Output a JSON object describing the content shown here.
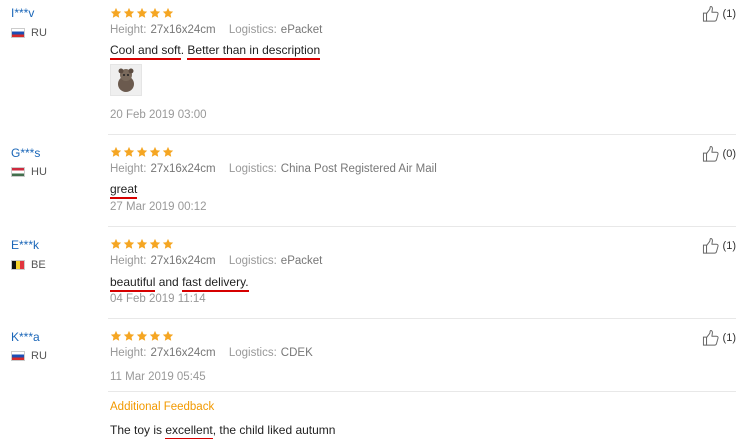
{
  "reviews": [
    {
      "user": "I***v",
      "country": "RU",
      "stars": 5,
      "height_label": "Height:",
      "height_value": "27x16x24cm",
      "logistics_label": "Logistics:",
      "logistics_value": "ePacket",
      "text_parts": [
        "Cool and soft",
        ". ",
        "Better than in description"
      ],
      "date": "20 Feb 2019 03:00",
      "likes": "(1)"
    },
    {
      "user": "G***s",
      "country": "HU",
      "stars": 5,
      "height_label": "Height:",
      "height_value": "27x16x24cm",
      "logistics_label": "Logistics:",
      "logistics_value": "China Post Registered Air Mail",
      "text_parts": [
        "great"
      ],
      "date": "27 Mar 2019 00:12",
      "likes": "(0)"
    },
    {
      "user": "E***k",
      "country": "BE",
      "stars": 5,
      "height_label": "Height:",
      "height_value": "27x16x24cm",
      "logistics_label": "Logistics:",
      "logistics_value": "ePacket",
      "text_parts": [
        "beautiful",
        " and ",
        "fast delivery."
      ],
      "date": "04 Feb 2019 11:14",
      "likes": "(1)"
    },
    {
      "user": "K***a",
      "country": "RU",
      "stars": 5,
      "height_label": "Height:",
      "height_value": "27x16x24cm",
      "logistics_label": "Logistics:",
      "logistics_value": "CDEK",
      "date": "11 Mar 2019 05:45",
      "likes": "(1)",
      "additional_title": "Additional Feedback",
      "additional_parts": [
        "The toy is ",
        "excellent",
        ", the child liked autumn"
      ]
    }
  ],
  "colors": {
    "star": "#f5a623",
    "link": "#1a66b8",
    "underline": "#d60000",
    "additional": "#f29900"
  },
  "icons": {
    "star": "star-icon",
    "like": "thumbs-up-icon"
  }
}
